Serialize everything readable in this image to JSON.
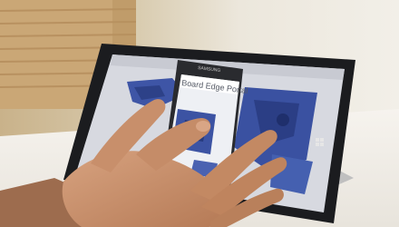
{
  "scene": {
    "description_free": true,
    "phone": {
      "brand_text": "SAMSUNG",
      "app_title": "Board Edge Portal",
      "app_subtitle": ""
    },
    "colors": {
      "wall": "#e9e4da",
      "blinds": "#c8b48c",
      "table": "#f4f1ea",
      "tablet_bezel": "#1b1c1f",
      "screen_bg": "#d9dbe2",
      "part_blue": "#3e55a6",
      "phone_body": "#2a2b2f",
      "skin": "#c8906a"
    }
  }
}
